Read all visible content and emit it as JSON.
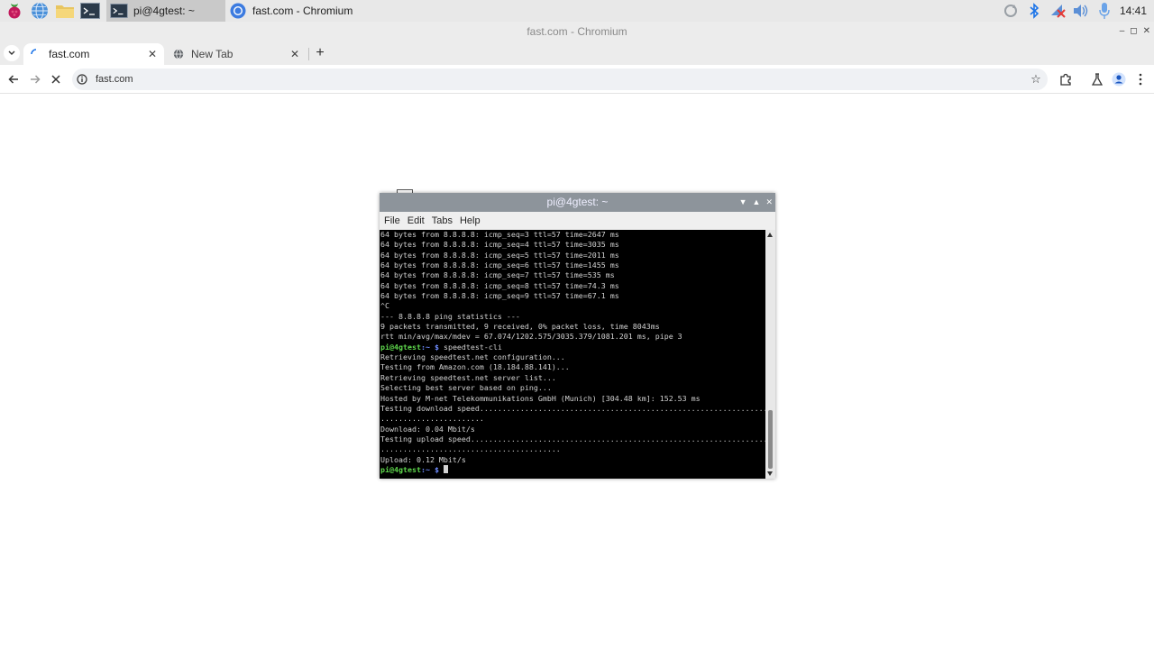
{
  "taskbar": {
    "launchers": [
      "raspberry-menu-icon",
      "browser-globe-icon",
      "file-manager-folder-icon",
      "terminal-icon"
    ],
    "tasks": [
      {
        "label": "pi@4gtest: ~",
        "icon": "terminal-icon",
        "active": true
      },
      {
        "label": "fast.com - Chromium",
        "icon": "chromium-icon",
        "active": false
      }
    ],
    "tray": [
      "sync-icon",
      "bluetooth-icon",
      "network-disconnected-icon",
      "volume-icon",
      "microphone-icon"
    ],
    "clock": "14:41"
  },
  "browser": {
    "window_title": "fast.com - Chromium",
    "tabs": [
      {
        "label": "fast.com",
        "active": true
      },
      {
        "label": "New Tab",
        "active": false
      }
    ],
    "address": "fast.com"
  },
  "terminal": {
    "title": "pi@4gtest: ~",
    "menu": [
      "File",
      "Edit",
      "Tabs",
      "Help"
    ],
    "lines": [
      {
        "text": "64 bytes from 8.8.8.8: icmp_seq=3 ttl=57 time=2647 ms"
      },
      {
        "text": "64 bytes from 8.8.8.8: icmp_seq=4 ttl=57 time=3035 ms"
      },
      {
        "text": "64 bytes from 8.8.8.8: icmp_seq=5 ttl=57 time=2011 ms"
      },
      {
        "text": "64 bytes from 8.8.8.8: icmp_seq=6 ttl=57 time=1455 ms"
      },
      {
        "text": "64 bytes from 8.8.8.8: icmp_seq=7 ttl=57 time=535 ms"
      },
      {
        "text": "64 bytes from 8.8.8.8: icmp_seq=8 ttl=57 time=74.3 ms"
      },
      {
        "text": "64 bytes from 8.8.8.8: icmp_seq=9 ttl=57 time=67.1 ms"
      },
      {
        "text": "^C"
      },
      {
        "text": "--- 8.8.8.8 ping statistics ---"
      },
      {
        "text": "9 packets transmitted, 9 received, 0% packet loss, time 8043ms"
      },
      {
        "text": "rtt min/avg/max/mdev = 67.074/1202.575/3035.379/1081.201 ms, pipe 3"
      },
      {
        "prompt_user": "pi@4gtest",
        "prompt_path": ":~ $",
        "text": " speedtest-cli"
      },
      {
        "text": "Retrieving speedtest.net configuration..."
      },
      {
        "text": "Testing from Amazon.com (18.184.88.141)..."
      },
      {
        "text": "Retrieving speedtest.net server list..."
      },
      {
        "text": "Selecting best server based on ping..."
      },
      {
        "text": "Hosted by M-net Telekommunikations GmbH (Munich) [304.48 km]: 152.53 ms"
      },
      {
        "text": "Testing download speed................................................................................"
      },
      {
        "text": "......................."
      },
      {
        "text": "Download: 0.04 Mbit/s"
      },
      {
        "text": "Testing upload speed................................................................................"
      },
      {
        "text": "........................................"
      },
      {
        "text": "Upload: 0.12 Mbit/s"
      },
      {
        "prompt_user": "pi@4gtest",
        "prompt_path": ":~ $",
        "text": " ",
        "cursor": true
      }
    ]
  }
}
